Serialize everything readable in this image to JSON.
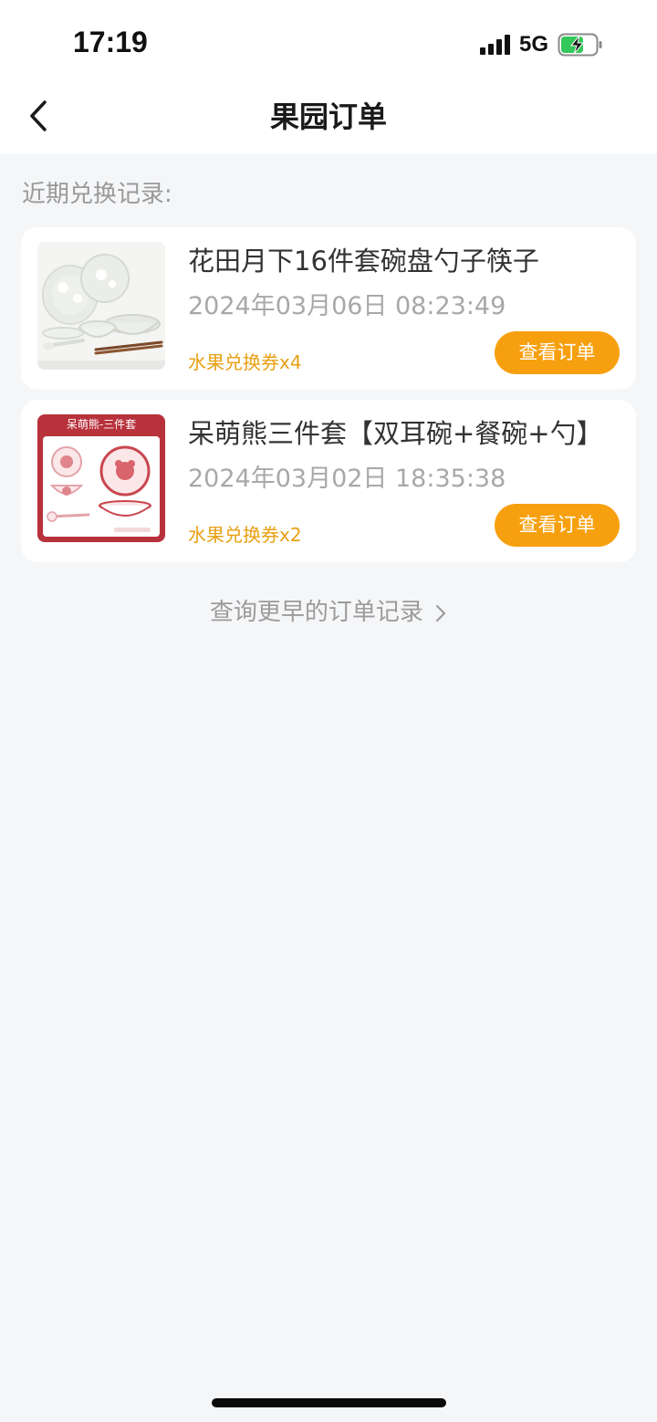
{
  "status_bar": {
    "time": "17:19",
    "network": "5G",
    "icons": [
      "signal-icon",
      "battery-charging-icon"
    ]
  },
  "nav": {
    "title": "果园订单",
    "back_icon": "chevron-left-icon"
  },
  "section_label": "近期兑换记录:",
  "orders": [
    {
      "title": "花田月下16件套碗盘勺子筷子",
      "time": "2024年03月06日 08:23:49",
      "cost": "水果兑换券x4",
      "button_label": "查看订单",
      "image": "floral-tableware-set"
    },
    {
      "title": "呆萌熊三件套【双耳碗+餐碗+勺】",
      "time": "2024年03月02日 18:35:38",
      "cost": "水果兑换券x2",
      "button_label": "查看订单",
      "image": "bear-bowl-set",
      "image_banner": "呆萌熊-三件套"
    }
  ],
  "more_link": {
    "label": "查询更早的订单记录",
    "icon": "chevron-right-icon"
  },
  "colors": {
    "accent": "#f7a00f",
    "cost_text": "#e8a013",
    "background": "#f5f6f8",
    "banner_red": "#b8323c"
  }
}
